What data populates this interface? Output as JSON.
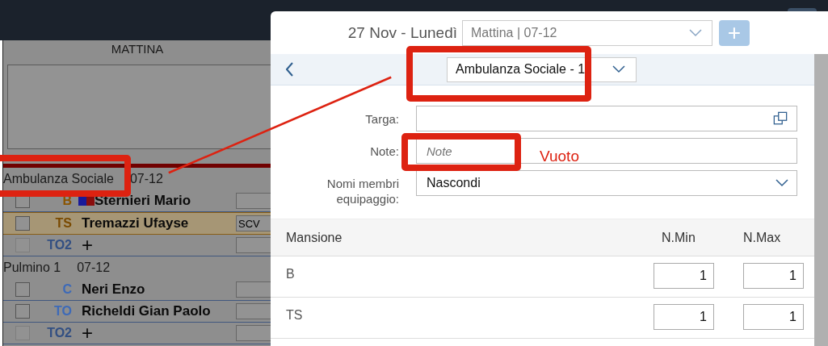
{
  "page": {
    "shift_title": "MATTINA",
    "groups": [
      {
        "title": "Ambulanza Sociale",
        "time": "07-12",
        "rows": [
          {
            "kind": "member",
            "role": "B",
            "color": "#8a5400",
            "name": "Sternieri Mario",
            "flag": true,
            "highlighted": false,
            "disabled": false,
            "note": ""
          },
          {
            "kind": "member",
            "role": "TS",
            "color": "#7a4a00",
            "name": "Tremazzi Ufayse",
            "flag": false,
            "highlighted": true,
            "disabled": false,
            "note": "SCV"
          },
          {
            "kind": "add",
            "role": "TO2",
            "color": "#324f82",
            "name": "+",
            "flag": false,
            "highlighted": false,
            "disabled": true,
            "note": ""
          }
        ]
      },
      {
        "title": "Pulmino 1",
        "time": "07-12",
        "rows": [
          {
            "kind": "member",
            "role": "C",
            "color": "#3d6ab8",
            "name": "Neri Enzo",
            "flag": false,
            "highlighted": false,
            "disabled": false,
            "note": ""
          },
          {
            "kind": "member",
            "role": "TO",
            "color": "#3d6ab8",
            "name": "Richeldi Gian Paolo",
            "flag": false,
            "highlighted": false,
            "disabled": false,
            "note": ""
          },
          {
            "kind": "add",
            "role": "TO2",
            "color": "#324f82",
            "name": "+",
            "flag": false,
            "highlighted": false,
            "disabled": true,
            "note": ""
          }
        ]
      }
    ]
  },
  "dialog": {
    "date": "27 Nov - Lunedì",
    "shift_select": "Mattina | 07-12",
    "add_button": "+",
    "vehicle_select": "Ambulanza Sociale - 1",
    "form": [
      {
        "kind": "input",
        "label": "Targa:",
        "copy_icon": true
      },
      {
        "kind": "input",
        "label": "Note:",
        "placeholder": "Note",
        "copy_icon": false
      },
      {
        "kind": "select",
        "label": "Nomi membri equipaggio:",
        "value": "Nascondi"
      }
    ],
    "table": {
      "columns": [
        "Mansione",
        "N.Min",
        "N.Max"
      ],
      "rows": [
        {
          "mansione": "B",
          "min": "1",
          "max": "1"
        },
        {
          "mansione": "TS",
          "min": "1",
          "max": "1"
        }
      ]
    }
  },
  "annotation": {
    "label": "Vuoto"
  }
}
